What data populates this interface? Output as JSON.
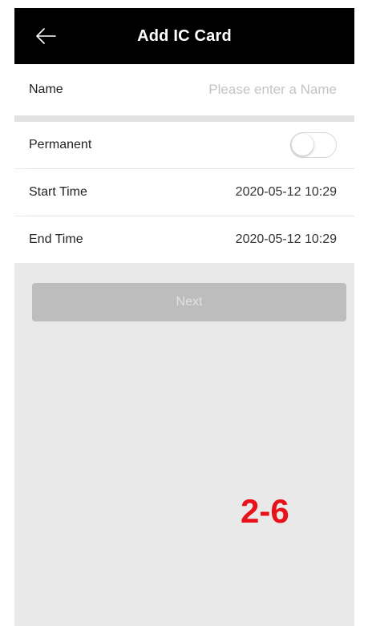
{
  "header": {
    "title": "Add IC Card",
    "back_icon": "arrow-left-icon"
  },
  "form": {
    "name_label": "Name",
    "name_placeholder": "Please enter a Name",
    "name_value": "",
    "permanent_label": "Permanent",
    "permanent_on": false,
    "start_label": "Start Time",
    "start_value": "2020-05-12 10:29",
    "end_label": "End Time",
    "end_value": "2020-05-12 10:29"
  },
  "actions": {
    "next_label": "Next"
  },
  "annotation": {
    "text": "2-6",
    "color": "#e8111a"
  },
  "colors": {
    "header_bg": "#000000",
    "page_bg": "#e9e9e9",
    "button_bg": "#bdbdbd"
  }
}
